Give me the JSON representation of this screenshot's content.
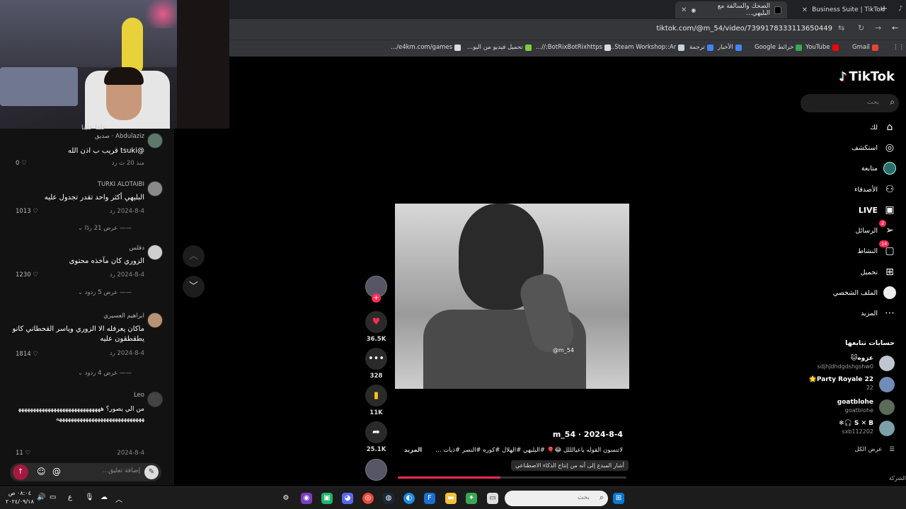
{
  "browser": {
    "tabs": [
      {
        "title": "Business Suite | TikTok"
      },
      {
        "title": "الضحك والسالفة مع البليهي..."
      }
    ],
    "url": "tiktok.com/@m_54/video/7399178333113650449",
    "bookmarks": [
      "Gmail",
      "YouTube",
      "خرائط Google",
      "الأخبار",
      "ترجمة",
      "Steam Workshop::Ar...",
      "BotRixBotRixhttps://...",
      "تحميل فيديو من اليو...",
      "e4km.com/games/..."
    ]
  },
  "comments": {
    "partial_top": "علقا علينا",
    "items": [
      {
        "name": "Abdulaziz · صديق",
        "text": "@tsuki قريب ب اذن الله",
        "meta": "منذ 20 ث   رد",
        "likes": "0"
      },
      {
        "name": "TURKI ALOTAIBI",
        "text": "البليهي أكثر واحد تقدر تجدول عليه",
        "meta": "2024-8-4   رد",
        "likes": "1013",
        "more": "عرض 21 ردًا"
      },
      {
        "name": "دقلس",
        "text": "الزوري كان مآخذه محتوى",
        "meta": "2024-8-4   رد",
        "likes": "1230",
        "more": "عرض 5 ردود"
      },
      {
        "name": "ابراهيم العسيري",
        "text": "ماكان يعرفله الا الزوري وياسر القحطاني كانو يطقطقون عليه",
        "meta": "2024-8-4   رد",
        "likes": "1814",
        "more": "عرض 4 ردود"
      },
      {
        "name": "Leo",
        "text": "من الي يصور؟ ههههههههههههههههههههههههههههههههههههههههههههههههههههههههههه",
        "meta": "2024-8-4",
        "likes": "11"
      }
    ],
    "input_placeholder": "إضافة تعليق..."
  },
  "video": {
    "watermark": "@m_54",
    "author": "m_54 · 2024-8-4",
    "caption": "لاتنسون القوله ياعيالللل 😂🎈 #البليهي #الهلال #كوره #النصر #ذيات ...",
    "more": "المزيد",
    "ai_label": "أشار المبدع إلى أنه من إنتاج الذكاء الاصطناعي",
    "progress": 0.45
  },
  "actions": {
    "likes": "36.5K",
    "comments": "328",
    "saves": "11K",
    "shares": "25.1K"
  },
  "sidebar": {
    "logo": "TikTok",
    "search_placeholder": "بحث",
    "nav": [
      {
        "label": "لك",
        "icon": "home-icon"
      },
      {
        "label": "استكشف",
        "icon": "compass-icon"
      },
      {
        "label": "متابعة",
        "icon": "following-icon"
      },
      {
        "label": "الأصدقاء",
        "icon": "friends-icon"
      },
      {
        "label": "LIVE",
        "icon": "live-icon"
      },
      {
        "label": "الرسائل",
        "icon": "messages-icon",
        "badge": "2"
      },
      {
        "label": "النشاط",
        "icon": "activity-icon",
        "badge": "14"
      },
      {
        "label": "تحميل",
        "icon": "upload-icon"
      },
      {
        "label": "الملف الشخصي",
        "icon": "profile-icon"
      },
      {
        "label": "المزيد",
        "icon": "more-icon"
      }
    ],
    "following_title": "حسابات تتابعها",
    "following": [
      {
        "name": "عزوه🐱",
        "sub": "sdjhjdhdgdshgshw0"
      },
      {
        "name": "Party Royale 22🌟",
        "sub": "22"
      },
      {
        "name": "goatblohe",
        "sub": "goatblohe"
      },
      {
        "name": "S ✕ B 🎧❄",
        "sub": "sxb112202"
      }
    ],
    "see_all": "عرض الكل",
    "footer": "الشركة"
  },
  "taskbar": {
    "search_placeholder": "بحث",
    "time": "٠٨:٠٤ ص",
    "date": "٢٠٢٤/٠٩/١٨",
    "lang": "ع"
  }
}
